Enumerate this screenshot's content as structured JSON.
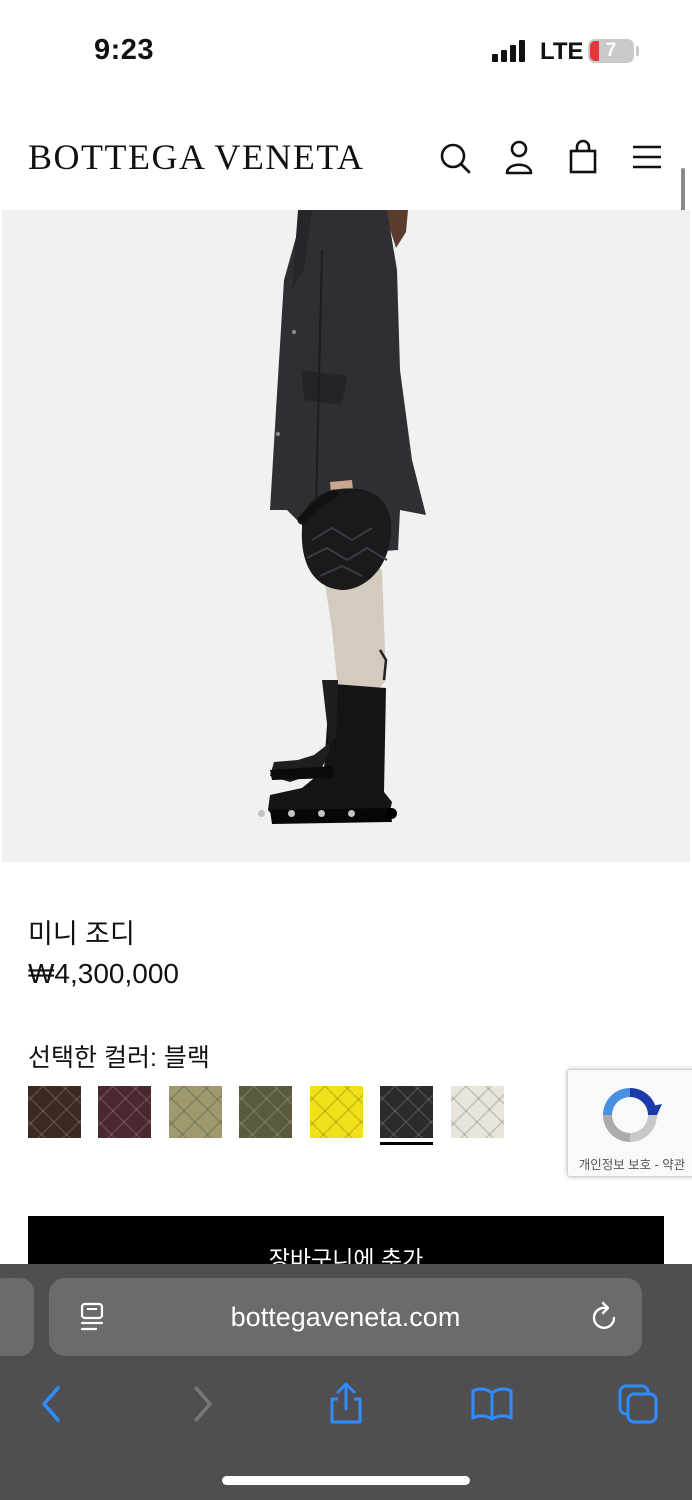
{
  "status": {
    "time": "9:23",
    "network": "LTE",
    "battery": "7"
  },
  "header": {
    "logo": "BOTTEGA VENETA",
    "icons": [
      "search-icon",
      "account-icon",
      "shopping-bag-icon",
      "menu-icon"
    ]
  },
  "gallery": {
    "image_description": "model in dark jacket holding black woven mini jodie bag",
    "slide_count": 5,
    "active_slide": 5
  },
  "product": {
    "name": "미니 조디",
    "price": "₩4,300,000",
    "color_label": "선택한 컬러: 블랙",
    "colors": [
      {
        "hex": "#3a2a22",
        "selected": false
      },
      {
        "hex": "#4a2830",
        "selected": false
      },
      {
        "hex": "#9e9a6e",
        "selected": false
      },
      {
        "hex": "#5b5a3e",
        "selected": false
      },
      {
        "hex": "#f0e11a",
        "selected": false
      },
      {
        "hex": "#2b2b2b",
        "selected": true
      },
      {
        "hex": "#e9e5dc",
        "selected": false
      }
    ],
    "add_to_cart": "장바구니에 추가"
  },
  "recaptcha": {
    "links": "개인정보 보호 - 약관"
  },
  "browser": {
    "url": "bottegaveneta.com",
    "toolbar_icons": [
      "back-icon",
      "forward-icon",
      "share-icon",
      "bookmarks-icon",
      "tabs-icon"
    ]
  }
}
